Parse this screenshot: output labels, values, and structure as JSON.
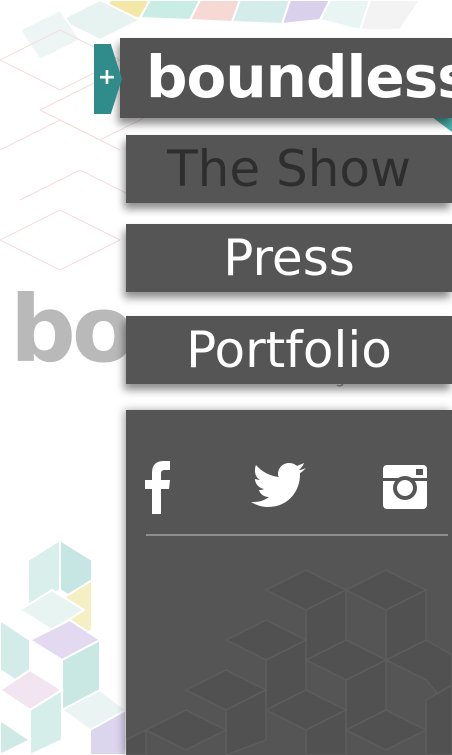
{
  "brand": {
    "logo_text": "boundless",
    "plus_symbol": "+",
    "watermark_text": "bo",
    "watermark_subtext": "Design Show",
    "accent_color": "#2f8c8a"
  },
  "menu": {
    "items": [
      {
        "label": "The Show",
        "current": true
      },
      {
        "label": "Press",
        "current": false
      },
      {
        "label": "Portfolio",
        "current": false
      }
    ]
  },
  "social": {
    "icons": [
      "facebook-icon",
      "twitter-icon",
      "instagram-icon"
    ]
  },
  "colors": {
    "panel": "#555555",
    "menu_text": "#ffffff",
    "current_text": "#2e2e2e"
  }
}
